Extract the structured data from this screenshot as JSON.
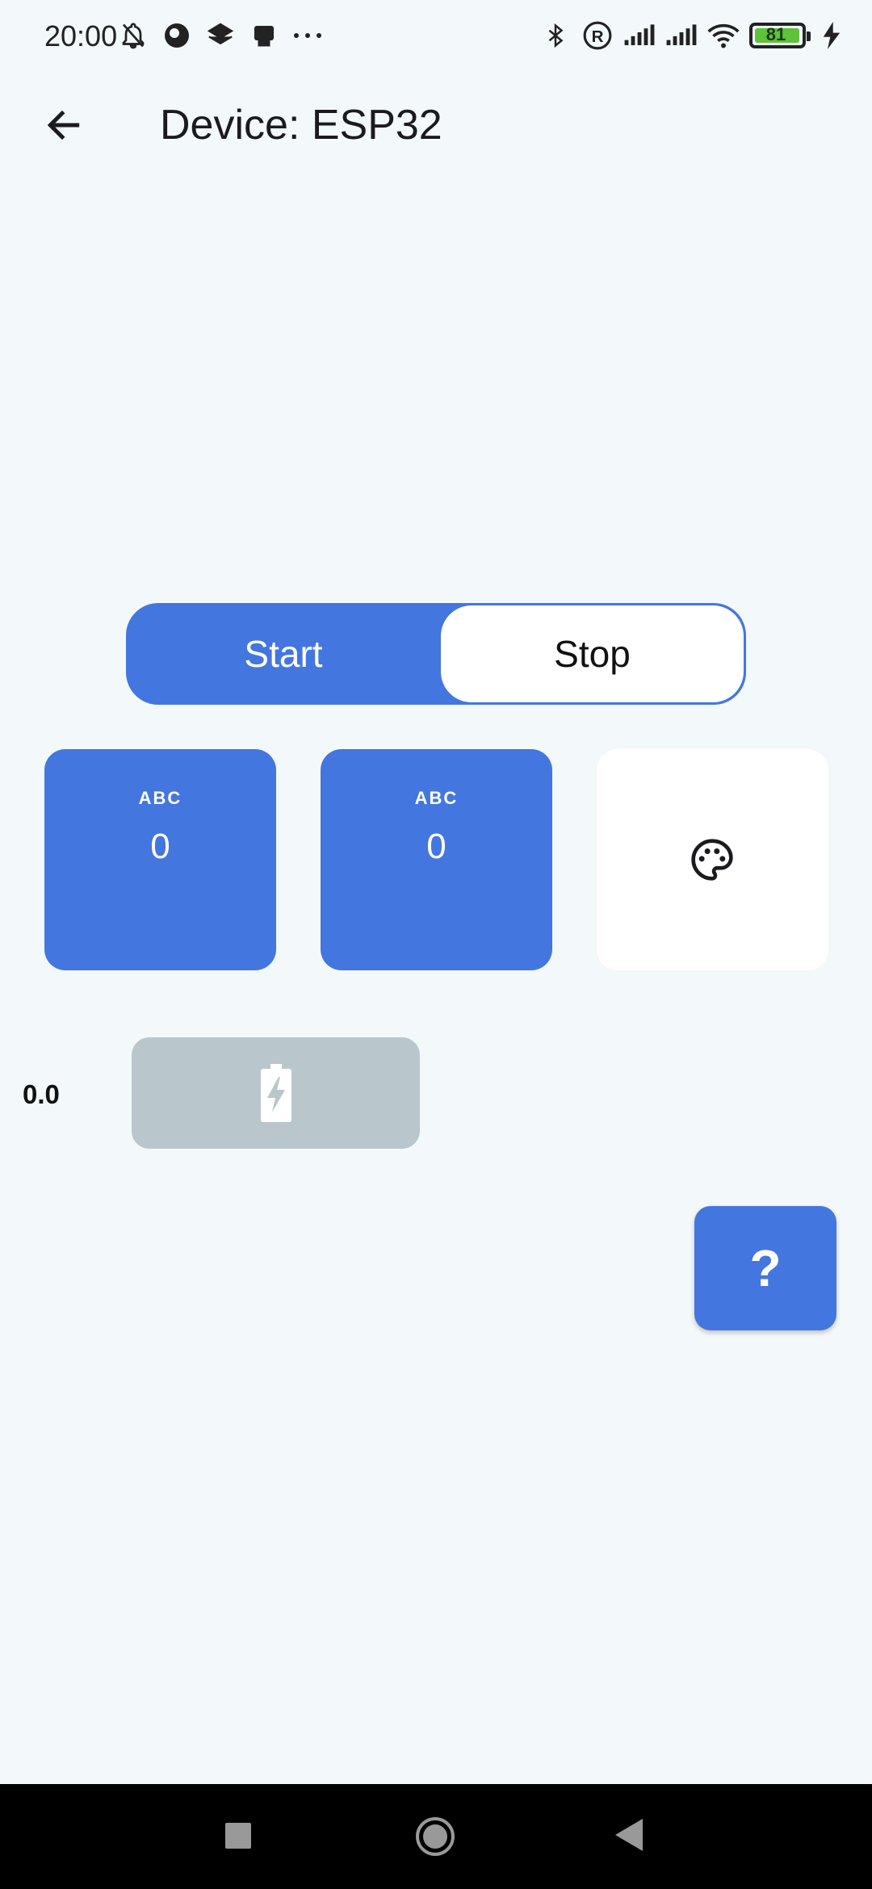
{
  "status_bar": {
    "time": "20:00",
    "left_icons": [
      "bell-off-icon",
      "app-icon",
      "layers-icon",
      "printer-icon",
      "more-dots-icon"
    ],
    "right_icons": [
      "bluetooth-icon",
      "registered-icon",
      "signal-icon",
      "signal-icon",
      "wifi-icon"
    ],
    "battery_level": "81",
    "charging": true
  },
  "app_bar": {
    "title": "Device: ESP32",
    "back_icon": "arrow-back-icon"
  },
  "toggle": {
    "start_label": "Start",
    "stop_label": "Stop",
    "selected": "Start"
  },
  "tiles": [
    {
      "label": "ABC",
      "value": "0"
    },
    {
      "label": "ABC",
      "value": "0"
    },
    {
      "icon": "palette-icon"
    }
  ],
  "battery_row": {
    "reading": "0.0",
    "icon": "battery-charging-icon"
  },
  "help_button": {
    "label": "?"
  },
  "colors": {
    "accent": "#4476e0",
    "background": "#f3f8fa",
    "disabled": "#b9c7cd"
  }
}
